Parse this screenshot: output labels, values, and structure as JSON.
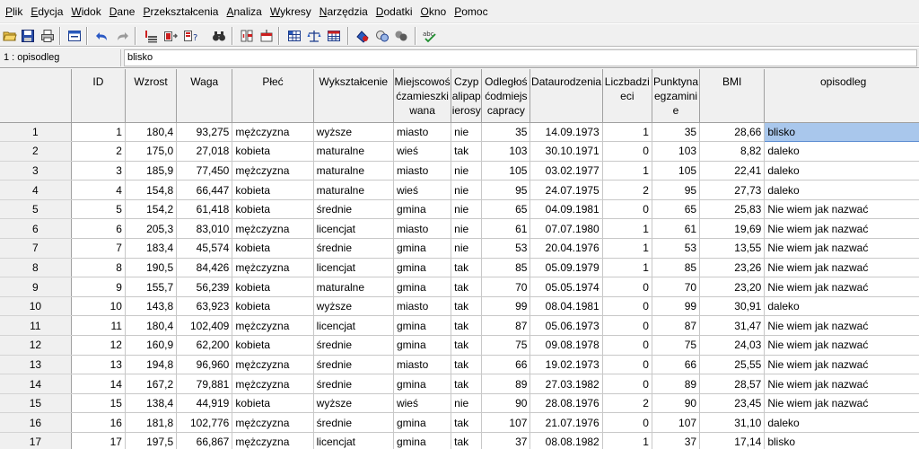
{
  "menu": [
    {
      "label": "Plik",
      "u": 0
    },
    {
      "label": "Edycja",
      "u": 0
    },
    {
      "label": "Widok",
      "u": 0
    },
    {
      "label": "Dane",
      "u": 0
    },
    {
      "label": "Przekształcenia",
      "u": 0
    },
    {
      "label": "Analiza",
      "u": 0
    },
    {
      "label": "Wykresy",
      "u": 0
    },
    {
      "label": "Narzędzia",
      "u": 0
    },
    {
      "label": "Dodatki",
      "u": 0
    },
    {
      "label": "Okno",
      "u": 0
    },
    {
      "label": "Pomoc",
      "u": 0
    }
  ],
  "toolbar_icons": [
    "open-folder-icon",
    "save-icon",
    "print-icon",
    "dialog-recall-icon",
    "undo-icon",
    "redo-icon",
    "goto-case-icon",
    "insert-variable-icon",
    "variables-icon",
    "find-icon",
    "insert-cases-icon",
    "split-file-icon",
    "select-cases-icon",
    "weight-cases-icon",
    "value-labels-icon",
    "use-sets-icon",
    "show-all-variables-icon",
    "circles-icon",
    "spell-check-icon"
  ],
  "cell_editor": {
    "reference": "1 : opisodleg",
    "value": "blisko"
  },
  "columns": [
    {
      "label": "ID",
      "align": "num"
    },
    {
      "label": "Wzrost",
      "align": "num"
    },
    {
      "label": "Waga",
      "align": "num"
    },
    {
      "label": "Płeć",
      "align": "str"
    },
    {
      "label": "Wykształcenie",
      "align": "str"
    },
    {
      "label": "Miejscowośćzamieszkiwana",
      "align": "str"
    },
    {
      "label": "Czypalipapierosy",
      "align": "str"
    },
    {
      "label": "Odległośćodmiejscapracy",
      "align": "num"
    },
    {
      "label": "Dataurodzenia",
      "align": "num"
    },
    {
      "label": "Liczbadzieci",
      "align": "num"
    },
    {
      "label": "Punktynaegzaminie",
      "align": "num"
    },
    {
      "label": "BMI",
      "align": "num"
    },
    {
      "label": "opisodleg",
      "align": "str"
    }
  ],
  "rows": [
    [
      "1",
      "1",
      "180,4",
      "93,275",
      "mężczyzna",
      "wyższe",
      "miasto",
      "nie",
      "35",
      "14.09.1973",
      "1",
      "35",
      "28,66",
      "blisko"
    ],
    [
      "2",
      "2",
      "175,0",
      "27,018",
      "kobieta",
      "maturalne",
      "wieś",
      "tak",
      "103",
      "30.10.1971",
      "0",
      "103",
      "8,82",
      "daleko"
    ],
    [
      "3",
      "3",
      "185,9",
      "77,450",
      "mężczyzna",
      "maturalne",
      "miasto",
      "nie",
      "105",
      "03.02.1977",
      "1",
      "105",
      "22,41",
      "daleko"
    ],
    [
      "4",
      "4",
      "154,8",
      "66,447",
      "kobieta",
      "maturalne",
      "wieś",
      "nie",
      "95",
      "24.07.1975",
      "2",
      "95",
      "27,73",
      "daleko"
    ],
    [
      "5",
      "5",
      "154,2",
      "61,418",
      "kobieta",
      "średnie",
      "gmina",
      "nie",
      "65",
      "04.09.1981",
      "0",
      "65",
      "25,83",
      "Nie wiem jak nazwać"
    ],
    [
      "6",
      "6",
      "205,3",
      "83,010",
      "mężczyzna",
      "licencjat",
      "miasto",
      "nie",
      "61",
      "07.07.1980",
      "1",
      "61",
      "19,69",
      "Nie wiem jak nazwać"
    ],
    [
      "7",
      "7",
      "183,4",
      "45,574",
      "kobieta",
      "średnie",
      "gmina",
      "nie",
      "53",
      "20.04.1976",
      "1",
      "53",
      "13,55",
      "Nie wiem jak nazwać"
    ],
    [
      "8",
      "8",
      "190,5",
      "84,426",
      "mężczyzna",
      "licencjat",
      "gmina",
      "tak",
      "85",
      "05.09.1979",
      "1",
      "85",
      "23,26",
      "Nie wiem jak nazwać"
    ],
    [
      "9",
      "9",
      "155,7",
      "56,239",
      "kobieta",
      "maturalne",
      "gmina",
      "tak",
      "70",
      "05.05.1974",
      "0",
      "70",
      "23,20",
      "Nie wiem jak nazwać"
    ],
    [
      "10",
      "10",
      "143,8",
      "63,923",
      "kobieta",
      "wyższe",
      "miasto",
      "tak",
      "99",
      "08.04.1981",
      "0",
      "99",
      "30,91",
      "daleko"
    ],
    [
      "11",
      "11",
      "180,4",
      "102,409",
      "mężczyzna",
      "licencjat",
      "gmina",
      "tak",
      "87",
      "05.06.1973",
      "0",
      "87",
      "31,47",
      "Nie wiem jak nazwać"
    ],
    [
      "12",
      "12",
      "160,9",
      "62,200",
      "kobieta",
      "średnie",
      "gmina",
      "tak",
      "75",
      "09.08.1978",
      "0",
      "75",
      "24,03",
      "Nie wiem jak nazwać"
    ],
    [
      "13",
      "13",
      "194,8",
      "96,960",
      "mężczyzna",
      "średnie",
      "miasto",
      "tak",
      "66",
      "19.02.1973",
      "0",
      "66",
      "25,55",
      "Nie wiem jak nazwać"
    ],
    [
      "14",
      "14",
      "167,2",
      "79,881",
      "mężczyzna",
      "średnie",
      "gmina",
      "tak",
      "89",
      "27.03.1982",
      "0",
      "89",
      "28,57",
      "Nie wiem jak nazwać"
    ],
    [
      "15",
      "15",
      "138,4",
      "44,919",
      "kobieta",
      "wyższe",
      "wieś",
      "nie",
      "90",
      "28.08.1976",
      "2",
      "90",
      "23,45",
      "Nie wiem jak nazwać"
    ],
    [
      "16",
      "16",
      "181,8",
      "102,776",
      "mężczyzna",
      "średnie",
      "gmina",
      "tak",
      "107",
      "21.07.1976",
      "0",
      "107",
      "31,10",
      "daleko"
    ],
    [
      "17",
      "17",
      "197,5",
      "66,867",
      "mężczyzna",
      "licencjat",
      "gmina",
      "tak",
      "37",
      "08.08.1982",
      "1",
      "37",
      "17,14",
      "blisko"
    ]
  ]
}
